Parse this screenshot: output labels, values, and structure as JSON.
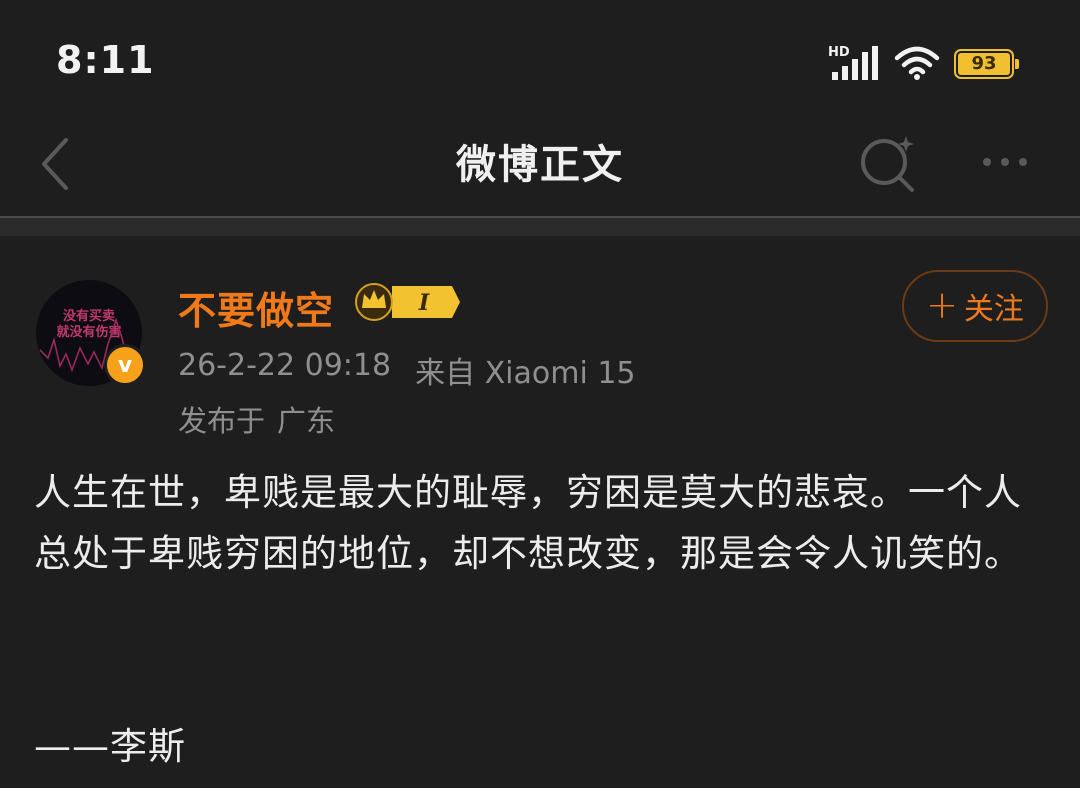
{
  "status_bar": {
    "time": "8:11",
    "network": "HD",
    "battery": "93",
    "battery_level_percent": 93,
    "icons": [
      "hd-signal-icon",
      "wifi-icon",
      "battery-icon"
    ]
  },
  "nav": {
    "title": "微博正文",
    "icons": [
      "back-arrow-icon",
      "search-icon",
      "more-icon"
    ]
  },
  "post": {
    "avatar_lines": [
      "没有买卖",
      "就没有伤害"
    ],
    "username": "不要做空",
    "member_level": "I",
    "date": "26-2-22 09:18",
    "source_prefix": "来自",
    "source": "Xiaomi 15",
    "location_prefix": "发布于",
    "location": "广东",
    "follow_label": "关注",
    "follow_plus": "+",
    "body": "人生在世，卑贱是最大的耻辱，穷困是莫大的悲哀。一个人总处于卑贱穷困的地位，却不想改变，那是会令人讥笑的。",
    "author": "——李斯"
  },
  "colors": {
    "background": "#1e1e1e",
    "accent": "#f07a1a",
    "gold": "#f0c030",
    "muted": "#8f8f8f"
  }
}
